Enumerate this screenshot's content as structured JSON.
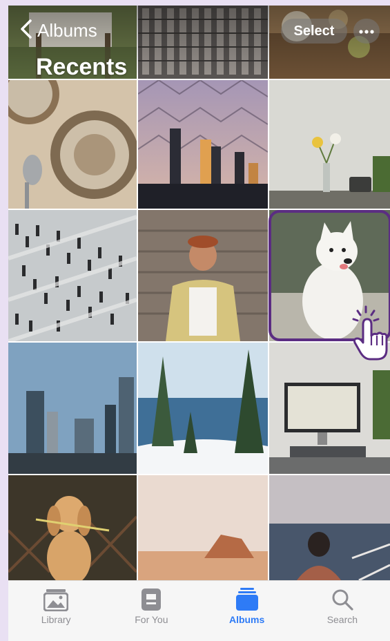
{
  "header": {
    "back_label": "Albums",
    "title": "Recents",
    "select_label": "Select",
    "more_icon": "ellipsis-icon"
  },
  "photos": [
    {
      "name": "photo-table-top",
      "colors": [
        "#5f6e3f",
        "#d8d4c8"
      ]
    },
    {
      "name": "photo-building-facade",
      "colors": [
        "#4f4c4b",
        "#8e8985"
      ]
    },
    {
      "name": "photo-food-board",
      "colors": [
        "#7a5a3a",
        "#c2a27a"
      ]
    },
    {
      "name": "photo-soup-bowl",
      "colors": [
        "#8b7359",
        "#d9c9b2"
      ]
    },
    {
      "name": "photo-city-skyline-dusk",
      "colors": [
        "#b8a4b6",
        "#3b3b4a"
      ]
    },
    {
      "name": "photo-flowers-desk",
      "colors": [
        "#dcdcd6",
        "#8e8f83"
      ]
    },
    {
      "name": "photo-crowd-crosswalk",
      "colors": [
        "#c2c6c9",
        "#2a2b2c"
      ]
    },
    {
      "name": "photo-woman-wood-wall",
      "colors": [
        "#7c6f64",
        "#c9b78d"
      ]
    },
    {
      "name": "photo-white-dog",
      "colors": [
        "#6f7567",
        "#f2f1ec"
      ]
    },
    {
      "name": "photo-skyscrapers-blue",
      "colors": [
        "#6b8fb0",
        "#374955"
      ]
    },
    {
      "name": "photo-lake-snow",
      "colors": [
        "#5a86a6",
        "#eff3f5"
      ]
    },
    {
      "name": "photo-computer-desk",
      "colors": [
        "#d6d5d1",
        "#3d3f41"
      ]
    },
    {
      "name": "photo-golden-dog",
      "colors": [
        "#3a3226",
        "#d7a569"
      ]
    },
    {
      "name": "photo-desert-rock",
      "colors": [
        "#e4d1c3",
        "#b27452"
      ]
    },
    {
      "name": "photo-woman-sea",
      "colors": [
        "#b8b6bd",
        "#3f4b5c"
      ]
    }
  ],
  "tabs": [
    {
      "label": "Library",
      "icon": "photo-library-icon",
      "active": false
    },
    {
      "label": "For You",
      "icon": "for-you-icon",
      "active": false
    },
    {
      "label": "Albums",
      "icon": "albums-icon",
      "active": true
    },
    {
      "label": "Search",
      "icon": "search-icon",
      "active": false
    }
  ],
  "colors": {
    "accent": "#2e7bf6",
    "highlight": "#5b2d82",
    "inactive_tab": "#8e8e93"
  }
}
